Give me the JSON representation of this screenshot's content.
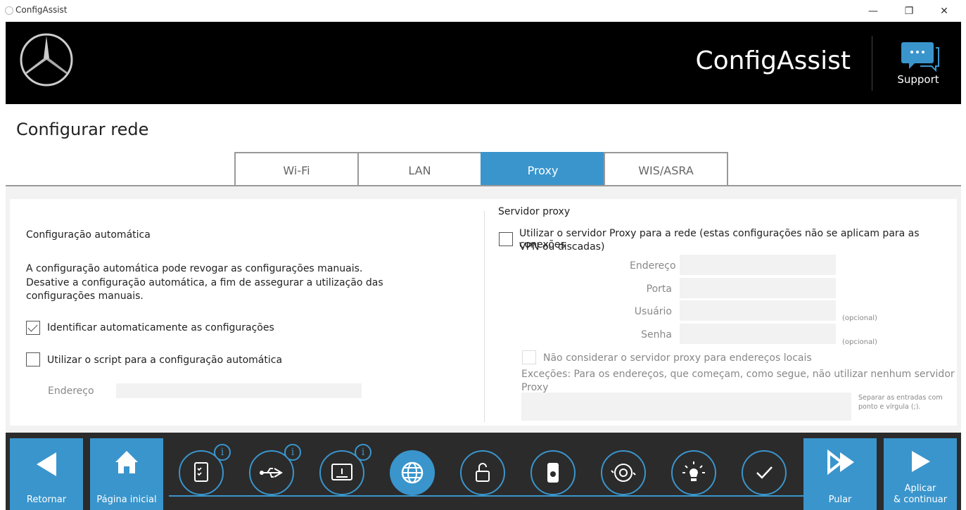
{
  "window": {
    "title": "ConfigAssist",
    "minimize": "—",
    "restore": "❐",
    "close": "✕"
  },
  "header": {
    "brand": "ConfigAssist",
    "support_label": "Support"
  },
  "page": {
    "title": "Configurar rede"
  },
  "tabs": [
    {
      "label": "Wi-Fi",
      "active": false
    },
    {
      "label": "LAN",
      "active": false
    },
    {
      "label": "Proxy",
      "active": true
    },
    {
      "label": "WIS/ASRA",
      "active": false
    }
  ],
  "auto_config": {
    "heading": "Configuração automática",
    "description_1": "A configuração automática pode revogar as configurações manuais.",
    "description_2": "Desative a configuração automática, a fim de assegurar a utilização das",
    "description_3": "configurações manuais.",
    "identify_label": "Identificar automaticamente as configurações",
    "identify_checked": true,
    "script_label": "Utilizar o script para a configuração automática",
    "script_checked": false,
    "address_label": "Endereço"
  },
  "proxy": {
    "heading": "Servidor proxy",
    "use_label_1": "Utilizar o servidor Proxy para a rede (estas configurações não se aplicam para as conexões",
    "use_label_2": "VPN ou discadas)",
    "use_checked": false,
    "address_label": "Endereço",
    "port_label": "Porta",
    "user_label": "Usuário",
    "password_label": "Senha",
    "optional_1": "(opcional)",
    "optional_2": "(opcional)",
    "bypass_label": "Não considerar o servidor proxy para endereços locais",
    "exceptions_1": "Exceções: Para os endereços, que começam, como segue, não utilizar nenhum servidor",
    "exceptions_2": "Proxy",
    "separator_hint_1": "Separar as entradas com",
    "separator_hint_2": "ponto e vírgula (;)."
  },
  "footer": {
    "back_label": "Retornar",
    "home_label": "Página inicial",
    "skip_label": "Pular",
    "apply_label_1": "Aplicar",
    "apply_label_2": "& continuar",
    "info_glyph": "i",
    "steps": [
      "checklist-icon",
      "usb-icon",
      "device-info-icon",
      "globe-icon",
      "lock-icon",
      "hardware-icon",
      "sync-icon",
      "light-icon",
      "check-icon"
    ],
    "accent": "#3a95cc"
  }
}
